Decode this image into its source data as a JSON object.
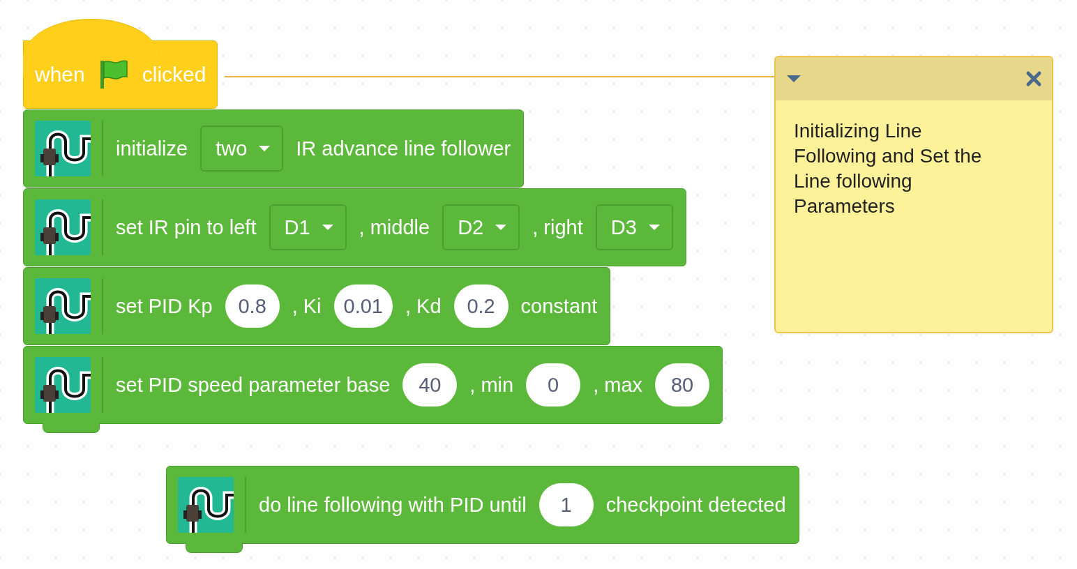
{
  "scripts": [
    {
      "hat": {
        "parts": [
          {
            "kind": "text",
            "text": "when"
          },
          {
            "kind": "flag"
          },
          {
            "kind": "text",
            "text": "clicked"
          }
        ]
      },
      "blocks": [
        {
          "parts": [
            {
              "kind": "text",
              "text": "initialize"
            },
            {
              "kind": "dropdown",
              "text": "two"
            },
            {
              "kind": "text",
              "text": "IR advance line follower"
            }
          ]
        },
        {
          "parts": [
            {
              "kind": "text",
              "text": "set IR pin to left"
            },
            {
              "kind": "dropdown",
              "text": "D1"
            },
            {
              "kind": "text",
              "text": ", middle"
            },
            {
              "kind": "dropdown",
              "text": "D2"
            },
            {
              "kind": "text",
              "text": ", right"
            },
            {
              "kind": "dropdown",
              "text": "D3"
            }
          ]
        },
        {
          "parts": [
            {
              "kind": "text",
              "text": "set PID Kp"
            },
            {
              "kind": "number",
              "text": "0.8"
            },
            {
              "kind": "text",
              "text": ", Ki"
            },
            {
              "kind": "number",
              "text": "0.01"
            },
            {
              "kind": "text",
              "text": ", Kd"
            },
            {
              "kind": "number",
              "text": "0.2"
            },
            {
              "kind": "text",
              "text": "constant"
            }
          ]
        },
        {
          "parts": [
            {
              "kind": "text",
              "text": "set PID speed parameter base"
            },
            {
              "kind": "number",
              "text": "40"
            },
            {
              "kind": "text",
              "text": ", min"
            },
            {
              "kind": "number",
              "text": "0"
            },
            {
              "kind": "text",
              "text": ", max"
            },
            {
              "kind": "number",
              "text": "80"
            }
          ]
        }
      ]
    },
    {
      "blocks": [
        {
          "parts": [
            {
              "kind": "text",
              "text": "do line following with PID until"
            },
            {
              "kind": "number",
              "text": "1"
            },
            {
              "kind": "text",
              "text": "checkpoint detected"
            }
          ]
        }
      ]
    }
  ],
  "comment": {
    "text": "Initializing Line Following and Set the Line following Parameters",
    "expanded": true
  }
}
